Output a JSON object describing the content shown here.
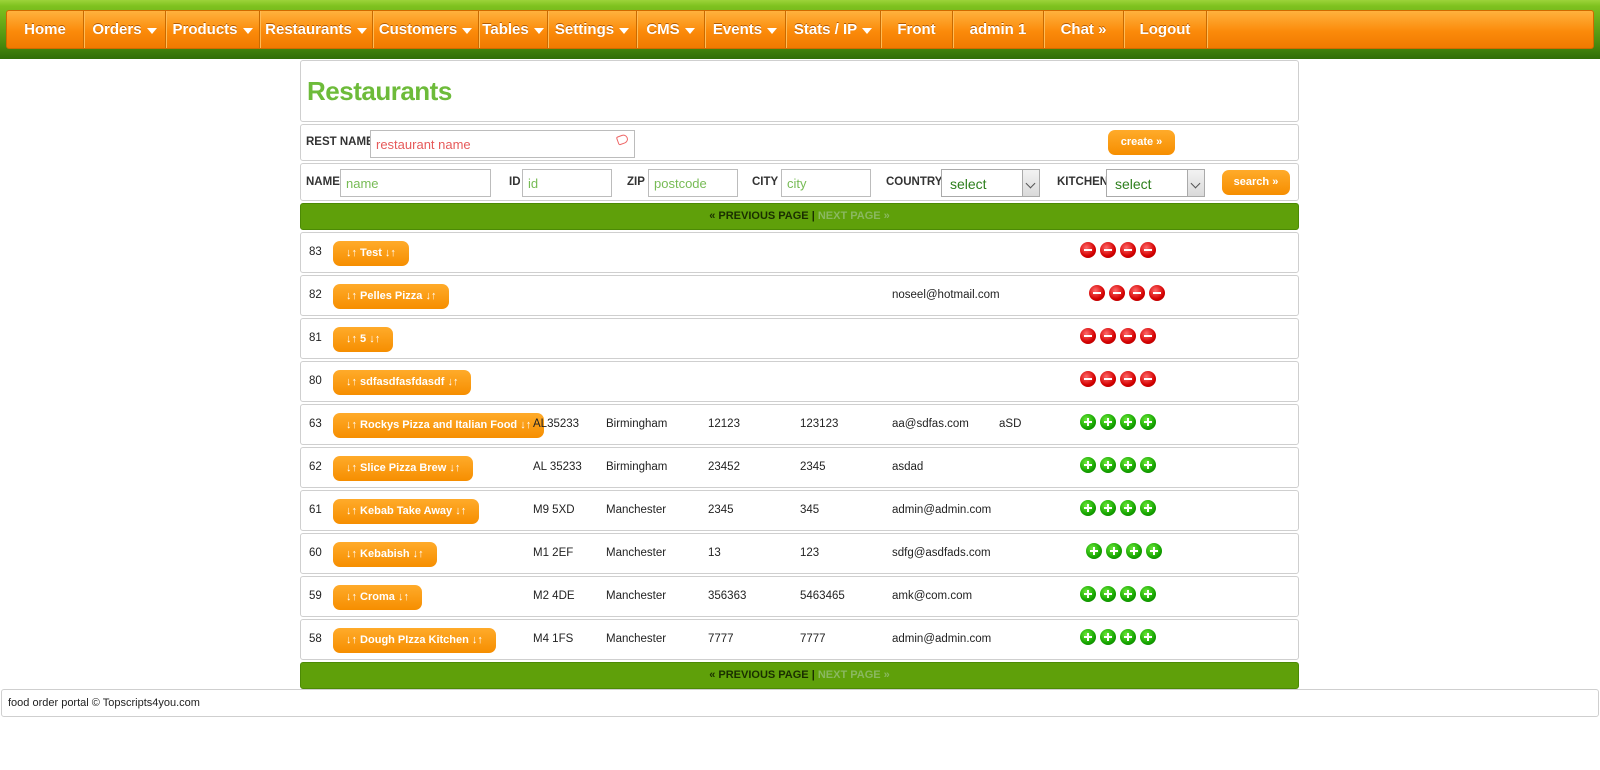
{
  "nav": [
    {
      "label": "Home",
      "caret": false
    },
    {
      "label": "Orders",
      "caret": true
    },
    {
      "label": "Products",
      "caret": true
    },
    {
      "label": "Restaurants",
      "caret": true
    },
    {
      "label": "Customers",
      "caret": true
    },
    {
      "label": "Tables",
      "caret": true
    },
    {
      "label": "Settings",
      "caret": true
    },
    {
      "label": "CMS",
      "caret": true
    },
    {
      "label": "Events",
      "caret": true
    },
    {
      "label": "Stats / IP",
      "caret": true
    },
    {
      "label": "Front",
      "caret": false
    },
    {
      "label": "admin 1",
      "caret": false
    },
    {
      "label": "Chat »",
      "caret": false
    },
    {
      "label": "Logout",
      "caret": false
    }
  ],
  "page_title": "Restaurants",
  "create": {
    "label": "REST NAME",
    "placeholder": "restaurant name",
    "button": "create »"
  },
  "search": {
    "name_label": "NAME",
    "name_placeholder": "name",
    "id_label": "ID",
    "id_placeholder": "id",
    "zip_label": "ZIP",
    "zip_placeholder": "postcode",
    "city_label": "CITY",
    "city_placeholder": "city",
    "country_label": "COUNTRY",
    "country_value": "select",
    "kitchen_label": "KITCHEN",
    "kitchen_value": "select",
    "button": "search »"
  },
  "pager": {
    "prev": "« PREVIOUS PAGE",
    "sep": " | ",
    "next": "NEXT PAGE »"
  },
  "rows": [
    {
      "id": "83",
      "name": "↓↑ Test ↓↑",
      "zip": "",
      "city": "",
      "phone": "",
      "fax": "",
      "email": "",
      "extra": "",
      "status": "minus"
    },
    {
      "id": "82",
      "name": "↓↑ Pelles Pizza ↓↑",
      "zip": "",
      "city": "",
      "phone": "",
      "fax": "",
      "email": "noseel@hotmail.com",
      "extra": "",
      "status": "minus"
    },
    {
      "id": "81",
      "name": "↓↑ 5 ↓↑",
      "zip": "",
      "city": "",
      "phone": "",
      "fax": "",
      "email": "",
      "extra": "",
      "status": "minus"
    },
    {
      "id": "80",
      "name": "↓↑ sdfasdfasfdasdf ↓↑",
      "zip": "",
      "city": "",
      "phone": "",
      "fax": "",
      "email": "",
      "extra": "",
      "status": "minus"
    },
    {
      "id": "63",
      "name": "↓↑ Rockys Pizza and Italian Food ↓↑",
      "zip": "AL35233",
      "city": "Birmingham",
      "phone": "12123",
      "fax": "123123",
      "email": "aa@sdfas.com",
      "extra": "aSD",
      "status": "plus"
    },
    {
      "id": "62",
      "name": "↓↑ Slice Pizza  Brew ↓↑",
      "zip": "AL 35233",
      "city": "Birmingham",
      "phone": "23452",
      "fax": "2345",
      "email": "asdad",
      "extra": "",
      "status": "plus"
    },
    {
      "id": "61",
      "name": "↓↑ Kebab Take Away ↓↑",
      "zip": "M9 5XD",
      "city": "Manchester",
      "phone": "2345",
      "fax": "345",
      "email": "admin@admin.com",
      "extra": "",
      "status": "plus"
    },
    {
      "id": "60",
      "name": "↓↑ Kebabish ↓↑",
      "zip": "M1 2EF",
      "city": "Manchester",
      "phone": "13",
      "fax": "123",
      "email": "sdfg@asdfads.com",
      "extra": "",
      "status": "plus"
    },
    {
      "id": "59",
      "name": "↓↑ Croma ↓↑",
      "zip": "M2 4DE",
      "city": "Manchester",
      "phone": "356363",
      "fax": "5463465",
      "email": "amk@com.com",
      "extra": "",
      "status": "plus"
    },
    {
      "id": "58",
      "name": "↓↑ Dough PIzza Kitchen ↓↑",
      "zip": "M4 1FS",
      "city": "Manchester",
      "phone": "7777",
      "fax": "7777",
      "email": "admin@admin.com",
      "extra": "",
      "status": "plus"
    }
  ],
  "footer": "food order portal © Topscripts4you.com"
}
